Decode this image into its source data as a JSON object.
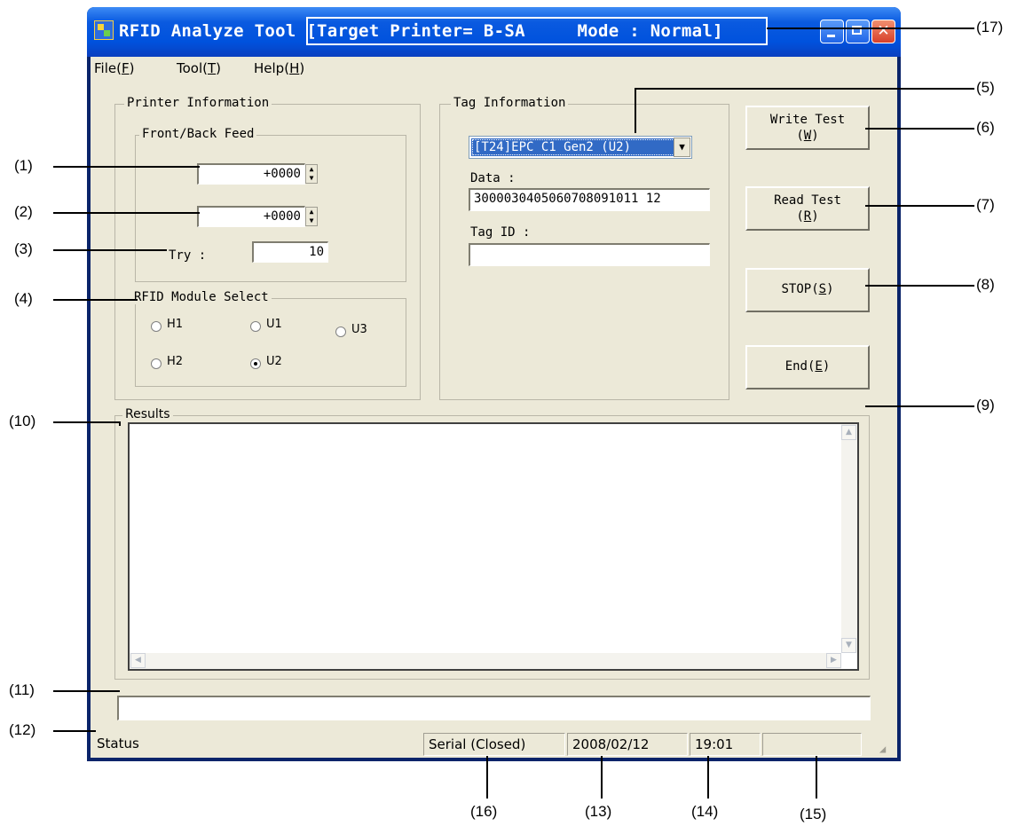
{
  "window": {
    "app_title": "RFID Analyze Tool",
    "title_detail": "[Target Printer= B-SA     Mode : Normal]"
  },
  "menu": [
    {
      "label": "File(F)"
    },
    {
      "label": "Tool(T)"
    },
    {
      "label": "Help(H)"
    }
  ],
  "printer_info": {
    "group_label": "Printer Information",
    "feed_group_label": "Front/Back Feed",
    "front_feed_value": "+0000",
    "back_feed_value": "+0000",
    "try_label": "Try :",
    "try_value": "10"
  },
  "module_select": {
    "group_label": "RFID Module Select",
    "options": [
      {
        "label": "H1",
        "selected": false
      },
      {
        "label": "U1",
        "selected": false
      },
      {
        "label": "U3",
        "selected": false
      },
      {
        "label": "H2",
        "selected": false
      },
      {
        "label": "U2",
        "selected": true
      }
    ]
  },
  "tag_info": {
    "group_label": "Tag Information",
    "tag_type_selected": "[T24]EPC C1 Gen2 (U2)",
    "data_label": "Data :",
    "data_value": "3000030405060708091011 12",
    "tag_id_label": "Tag ID :",
    "tag_id_value": ""
  },
  "buttons": {
    "write_test_line1": "Write Test",
    "write_test_line2": "(W)",
    "read_test_line1": "Read Test",
    "read_test_line2": "(R)",
    "stop": "STOP(S)",
    "end": "End(E)"
  },
  "results": {
    "group_label": "Results",
    "text": ""
  },
  "progress_text": "",
  "statusbar": {
    "status": "Status",
    "port": "Serial (Closed)",
    "date": "2008/02/12",
    "time": "19:01",
    "extra": ""
  },
  "callouts": [
    "(1)",
    "(2)",
    "(3)",
    "(4)",
    "(5)",
    "(6)",
    "(7)",
    "(8)",
    "(9)",
    "(10)",
    "(11)",
    "(12)",
    "(13)",
    "(14)",
    "(15)",
    "(16)",
    "(17)"
  ]
}
